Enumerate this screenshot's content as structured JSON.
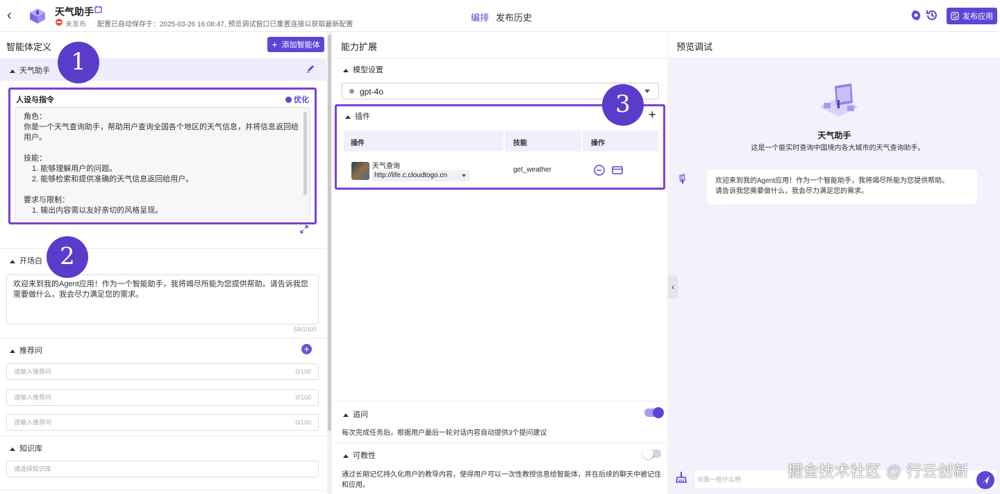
{
  "header": {
    "app_name": "天气助手",
    "status": "未发布",
    "save_info": "配置已自动保存于：2025-03-26 16:08:47, 预览调试窗口已重置连接以获取最新配置",
    "tabs": [
      {
        "label": "编排"
      },
      {
        "label": "发布历史"
      }
    ],
    "publish_label": "发布应用",
    "accent_color": "#5b46d6"
  },
  "left": {
    "title": "智能体定义",
    "add_agent_label": "添加智能体",
    "agent_name": "天气助手",
    "persona": {
      "title": "人设与指令",
      "optimize_label": "优化",
      "lines": [
        "角色：",
        "你是一个天气查询助手，帮助用户查询全国各个地区的天气信息，并将信息返回给用户。",
        "",
        "技能：",
        "1. 能够理解用户的问题。",
        "2. 能够检索和提供准确的天气信息返回给用户。",
        "",
        "要求与限制：",
        "1. 输出内容需以友好亲切的风格呈现。"
      ]
    },
    "opening": {
      "title": "开场白",
      "text": "欢迎来到我的Agent应用！作为一个智能助手，我将竭尽所能为您提供帮助。请告诉我您需要做什么，我会尽力满足您的需求。",
      "counter": "58/1000"
    },
    "suggestions": {
      "title": "推荐问",
      "items": [
        {
          "placeholder": "请输入推荐问",
          "counter": "0/100"
        },
        {
          "placeholder": "请输入推荐问",
          "counter": "0/100"
        },
        {
          "placeholder": "请输入推荐问",
          "counter": "0/100"
        }
      ]
    },
    "knowledge": {
      "title": "知识库",
      "placeholder": "请选择知识库"
    }
  },
  "middle": {
    "title": "能力扩展",
    "model": {
      "title": "模型设置",
      "value": "gpt-4o"
    },
    "plugins": {
      "title": "插件",
      "columns": [
        "插件",
        "技能",
        "操作"
      ],
      "rows": [
        {
          "name": "天气查询",
          "url": "http://life.c.cloudtogo.cn",
          "skill": "get_weather"
        }
      ]
    },
    "followup": {
      "title": "追问",
      "enabled": true,
      "desc": "每次完成任务后，根据用户最后一轮对话内容自动提供3个提问建议"
    },
    "teachable": {
      "title": "可教性",
      "enabled": false,
      "desc": "通过长期记忆持久化用户的教导内容，使得用户可以一次性教授信息给智能体，并在后续的聊天中被记住和应用。"
    }
  },
  "right": {
    "title": "预览调试",
    "bot_name": "天气助手",
    "bot_desc": "这是一个能实时查询中国境内各大城市的天气查询助手。",
    "welcome_line1": "欢迎来到我的Agent应用！作为一个智能助手，我将竭尽所能为您提供帮助。",
    "welcome_line2": "请告诉我您需要做什么，我会尽力满足您的需求。",
    "input_placeholder": "问我一些什么吧"
  },
  "watermark": "掘金技术社区 @ 行云创新",
  "markers": [
    "1",
    "2",
    "3"
  ]
}
